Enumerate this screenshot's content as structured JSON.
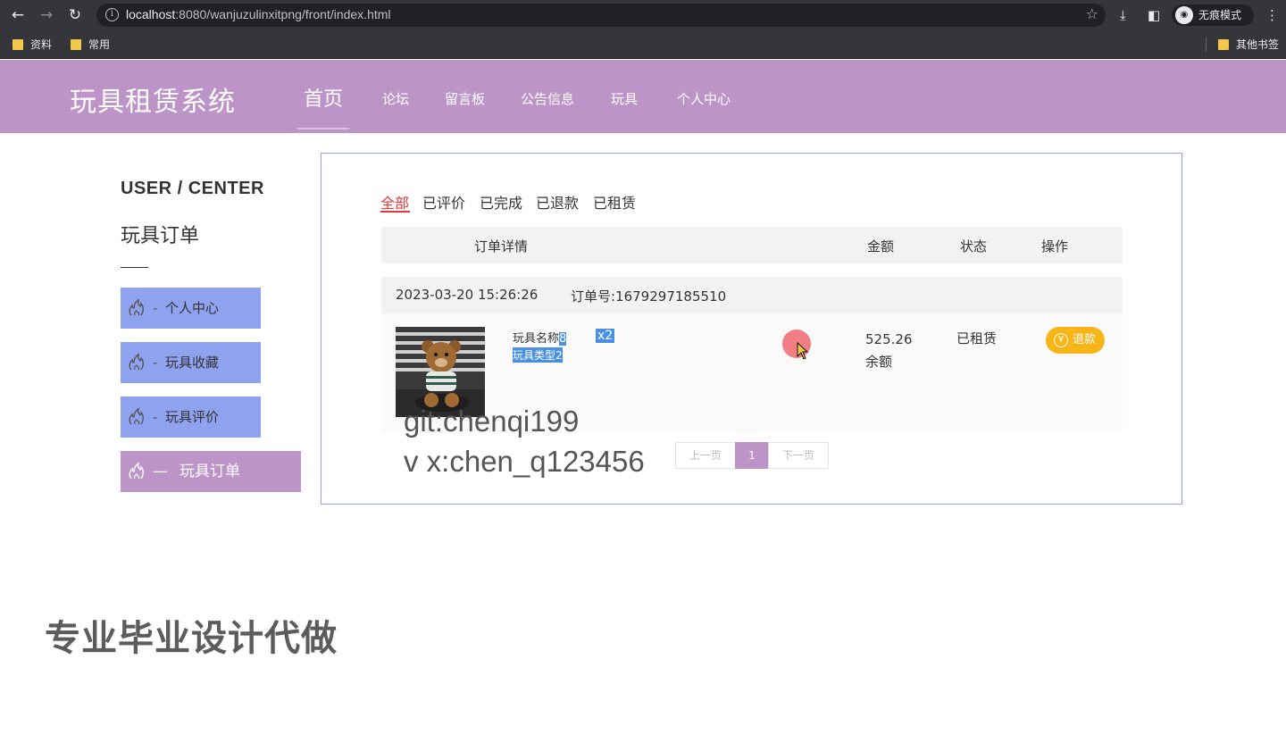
{
  "browser": {
    "url_host": "localhost",
    "url_rest": ":8080/wanjuzulinxitpng/front/index.html",
    "profile_label": "无痕模式",
    "bookmarks": [
      "资料",
      "常用"
    ],
    "other_bookmarks": "其他书签"
  },
  "header": {
    "logo": "玩具租赁系统",
    "nav": [
      "首页",
      "论坛",
      "留言板",
      "公告信息",
      "玩具",
      "个人中心"
    ]
  },
  "sidebar": {
    "title_en": "USER / CENTER",
    "title_cn": "玩具订单",
    "items": [
      {
        "dash": "-",
        "label": "个人中心"
      },
      {
        "dash": "-",
        "label": "玩具收藏"
      },
      {
        "dash": "-",
        "label": "玩具评价"
      },
      {
        "dash": "—",
        "label": "玩具订单"
      }
    ]
  },
  "tabs": [
    "全部",
    "已评价",
    "已完成",
    "已退款",
    "已租赁"
  ],
  "table_header": {
    "detail": "订单详情",
    "amount": "金额",
    "status": "状态",
    "action": "操作"
  },
  "order": {
    "date": "2023-03-20 15:26:26",
    "order_no": "订单号:1679297185510",
    "name_prefix": "玩具名称",
    "name_suffix": "8",
    "qty": "x2",
    "type": "玩具类型2",
    "price": "525.26",
    "pay_method": "余额",
    "status": "已租赁",
    "refund_label": "退款"
  },
  "pager": {
    "prev": "上一页",
    "current": "1",
    "next": "下一页"
  },
  "watermarks": {
    "git": "git:chenqi199",
    "vx": "v x:chen_q123456",
    "ad": "专业毕业设计代做"
  },
  "colors": {
    "header": "#bd94c8",
    "sidebar_item": "#8fa2f0",
    "active_tab": "#e4393c",
    "refund_button": "#f7b518",
    "selection": "#4a90e2"
  }
}
